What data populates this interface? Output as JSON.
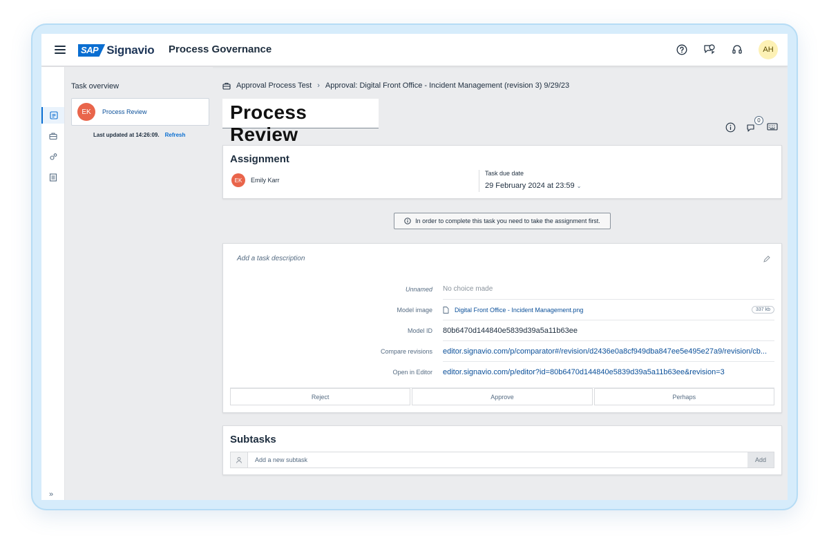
{
  "header": {
    "brand_sap": "SAP",
    "brand_name": "Signavio",
    "app_title": "Process Governance",
    "user_initials": "AH"
  },
  "overview": {
    "title": "Task overview",
    "task_initials": "EK",
    "task_label": "Process Review",
    "last_updated": "Last updated at 14:26:09.",
    "refresh_label": "Refresh"
  },
  "breadcrumb": {
    "parent": "Approval Process Test",
    "current": "Approval: Digital Front Office - Incident Management (revision 3) 9/29/23"
  },
  "page_title": "Process Review",
  "comment_count": "0",
  "assignment": {
    "title": "Assignment",
    "assignee_initials": "EK",
    "assignee_name": "Emily Karr",
    "due_label": "Task due date",
    "due_value": "29 February 2024 at 23:59"
  },
  "notice": "In order to complete this task you need to take the assignment first.",
  "details": {
    "description_placeholder": "Add a task description",
    "rows": [
      {
        "key": "Unnamed",
        "value": "No choice made"
      },
      {
        "key": "Model image",
        "value": "Digital Front Office - Incident Management.png",
        "size": "337 kb"
      },
      {
        "key": "Model ID",
        "value": "80b6470d144840e5839d39a5a11b63ee"
      },
      {
        "key": "Compare revisions",
        "value": "editor.signavio.com/p/comparator#/revision/d2436e0a8cf949dba847ee5e495e27a9/revision/cb..."
      },
      {
        "key": "Open in Editor",
        "value": "editor.signavio.com/p/editor?id=80b6470d144840e5839d39a5a11b63ee&revision=3"
      }
    ],
    "actions": {
      "reject": "Reject",
      "approve": "Approve",
      "perhaps": "Perhaps"
    }
  },
  "subtasks": {
    "title": "Subtasks",
    "placeholder": "Add a new subtask",
    "add_label": "Add"
  },
  "colors": {
    "accent": "#0a6ed1",
    "avatar_ek": "#e9654b",
    "avatar_ah": "#fdf1b5"
  }
}
